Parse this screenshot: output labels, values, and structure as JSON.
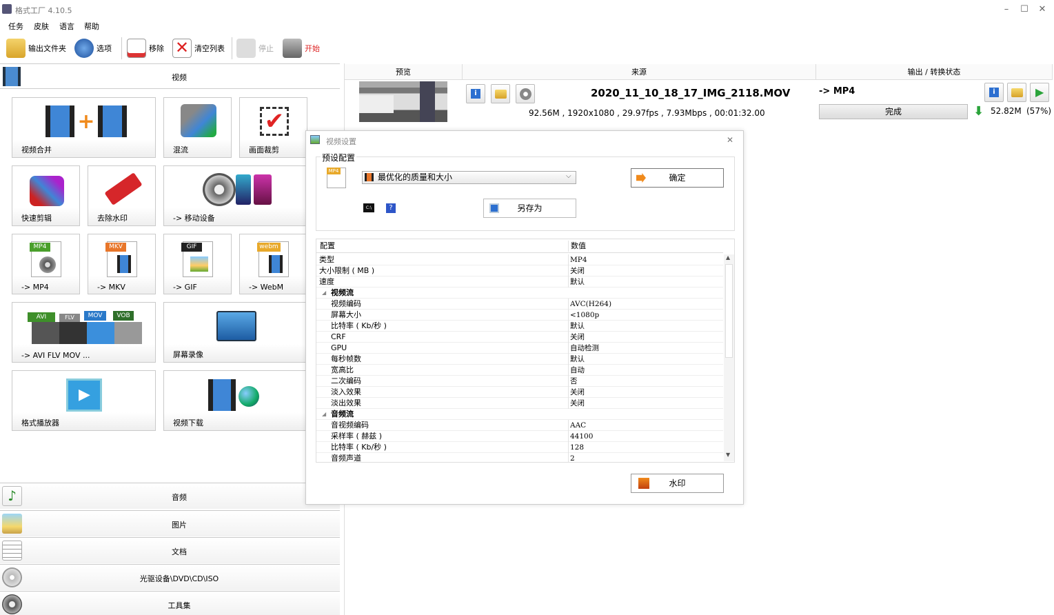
{
  "window": {
    "title": "格式工厂 4.10.5",
    "minimize": "–",
    "maximize": "☐",
    "close": "✕"
  },
  "menu": [
    "任务",
    "皮肤",
    "语言",
    "帮助"
  ],
  "toolbar": {
    "output_folder": "输出文件夹",
    "options": "选项",
    "remove": "移除",
    "clear_list": "清空列表",
    "stop": "停止",
    "start": "开始"
  },
  "left": {
    "video_header": "视频",
    "cards": [
      "视频合并",
      "混流",
      "画面裁剪",
      "快速剪辑",
      "去除水印",
      "-> 移动设备",
      "-> MP4",
      "-> MKV",
      "-> GIF",
      "-> WebM",
      "-> AVI FLV MOV ...",
      "屏幕录像",
      "格式播放器",
      "视频下载"
    ],
    "badges": {
      "mp4": "MP4",
      "mkv": "MKV",
      "gif": "GIF",
      "webm": "webm",
      "avi": "AVI",
      "flv": "FLV",
      "mov": "MOV",
      "vob": "VOB"
    },
    "categories": [
      "音频",
      "图片",
      "文档",
      "光驱设备\\DVD\\CD\\ISO",
      "工具集"
    ]
  },
  "task_list": {
    "columns": [
      "预览",
      "来源",
      "输出 / 转换状态"
    ],
    "item": {
      "filename": "2020_11_10_18_17_IMG_2118.MOV",
      "meta": "92.56M , 1920x1080 , 29.97fps , 7.93Mbps , 00:01:32.00",
      "output_format": "-> MP4",
      "status": "完成",
      "output_size": "52.82M",
      "output_ratio": "(57%)"
    }
  },
  "dialog": {
    "title": "视频设置",
    "close": "✕",
    "preset_group": "预设配置",
    "preset_value": "最优化的质量和大小",
    "ok": "确定",
    "save_as": "另存为",
    "watermark": "水印",
    "help_badge": "?",
    "mp4_badge": "MP4",
    "cmd_badge": "C:\\",
    "grid_headers": [
      "配置",
      "数值"
    ],
    "rows": [
      {
        "k": "类型",
        "v": "MP4",
        "indent": false
      },
      {
        "k": "大小限制 ( MB )",
        "v": "关闭",
        "indent": false
      },
      {
        "k": "速度",
        "v": "默认",
        "indent": false
      },
      {
        "k": "视频流",
        "v": "",
        "group": true
      },
      {
        "k": "视频编码",
        "v": "AVC(H264)",
        "indent": true
      },
      {
        "k": "屏幕大小",
        "v": "<1080p",
        "indent": true
      },
      {
        "k": "比特率 ( Kb/秒 )",
        "v": "默认",
        "indent": true
      },
      {
        "k": "CRF",
        "v": "关闭",
        "indent": true
      },
      {
        "k": "GPU",
        "v": "自动检测",
        "indent": true
      },
      {
        "k": "每秒帧数",
        "v": "默认",
        "indent": true
      },
      {
        "k": "宽高比",
        "v": "自动",
        "indent": true
      },
      {
        "k": "二次编码",
        "v": "否",
        "indent": true
      },
      {
        "k": "淡入效果",
        "v": "关闭",
        "indent": true
      },
      {
        "k": "淡出效果",
        "v": "关闭",
        "indent": true
      },
      {
        "k": "音频流",
        "v": "",
        "group": true
      },
      {
        "k": "音视频编码",
        "v": "AAC",
        "indent": true
      },
      {
        "k": "采样率 ( 赫兹 )",
        "v": "44100",
        "indent": true
      },
      {
        "k": "比特率 ( Kb/秒 )",
        "v": "128",
        "indent": true
      },
      {
        "k": "音频声道",
        "v": "2",
        "indent": true
      }
    ]
  }
}
